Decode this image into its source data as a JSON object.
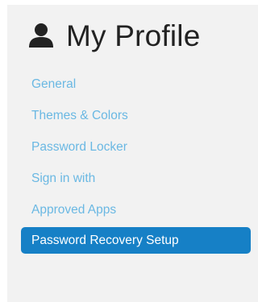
{
  "header": {
    "icon": "user-icon",
    "title": "My Profile"
  },
  "nav": {
    "items": [
      {
        "label": "General",
        "active": false
      },
      {
        "label": "Themes & Colors",
        "active": false
      },
      {
        "label": "Password Locker",
        "active": false
      },
      {
        "label": "Sign in with",
        "active": false
      },
      {
        "label": "Approved Apps",
        "active": false
      },
      {
        "label": "Password Recovery Setup",
        "active": true
      }
    ]
  },
  "colors": {
    "link": "#6ab8e3",
    "active_bg": "#1680c6",
    "active_text": "#ffffff",
    "panel_bg": "#f2f2f2",
    "title": "#222222"
  }
}
